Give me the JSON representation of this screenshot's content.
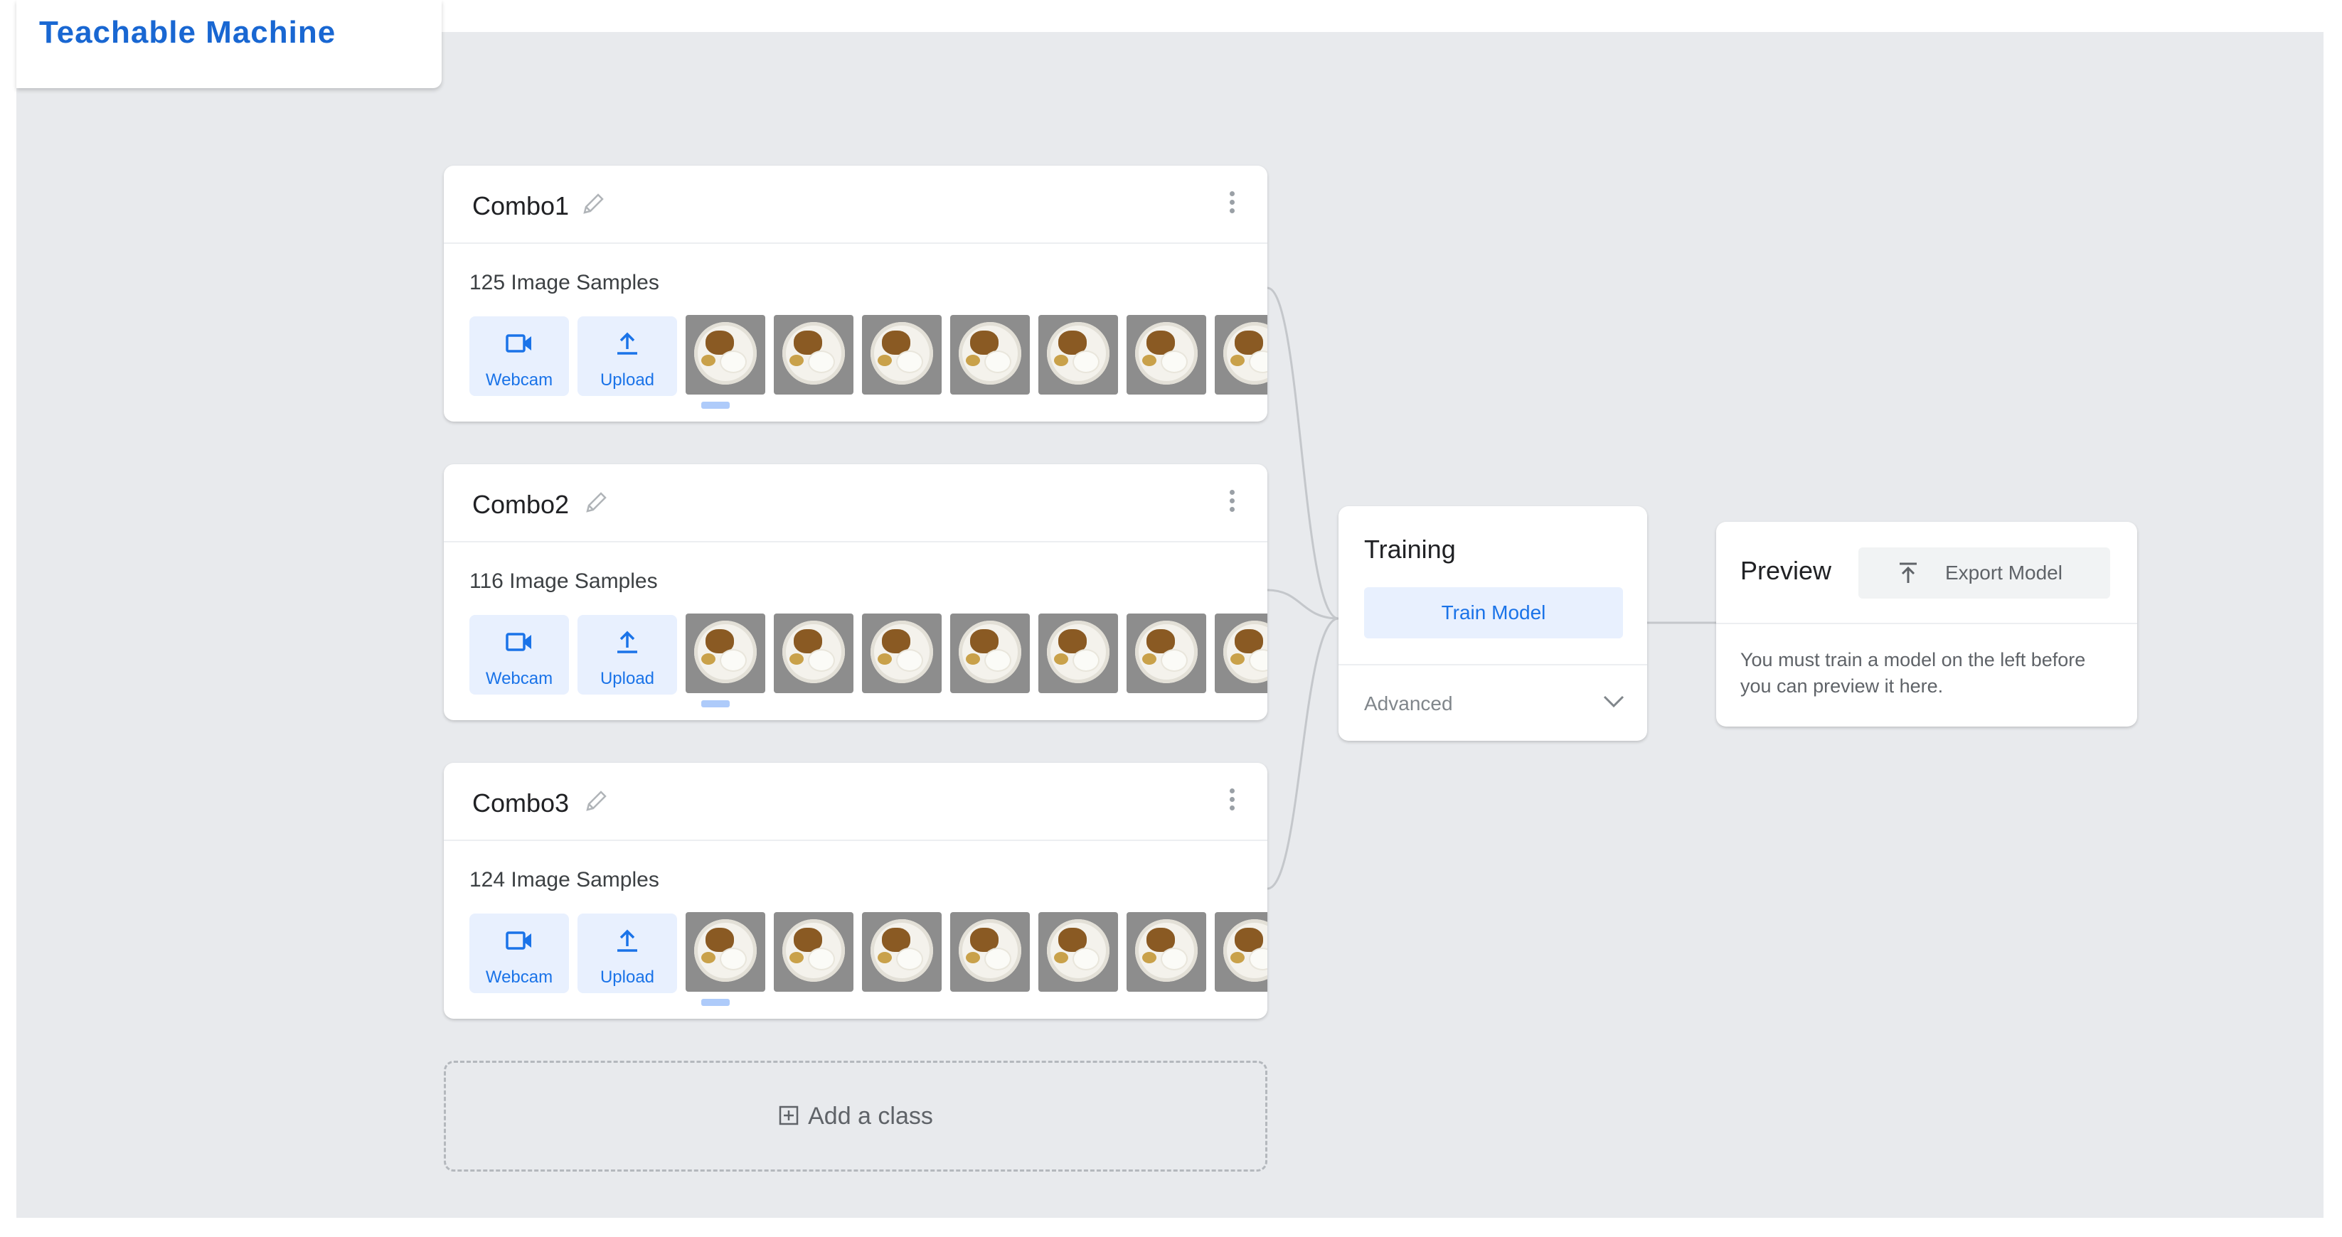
{
  "app": {
    "title": "Teachable Machine"
  },
  "classes": [
    {
      "name": "Combo1",
      "samples": "125 Image Samples",
      "webcam_label": "Webcam",
      "upload_label": "Upload"
    },
    {
      "name": "Combo2",
      "samples": "116 Image Samples",
      "webcam_label": "Webcam",
      "upload_label": "Upload"
    },
    {
      "name": "Combo3",
      "samples": "124 Image Samples",
      "webcam_label": "Webcam",
      "upload_label": "Upload"
    }
  ],
  "add_class": {
    "label": "Add a class"
  },
  "training": {
    "title": "Training",
    "button_label": "Train Model",
    "advanced_label": "Advanced"
  },
  "preview": {
    "title": "Preview",
    "export_label": "Export Model",
    "message": "You must train a model on the left before you can preview it here."
  },
  "icons": {
    "edit": "pencil-icon",
    "menu": "more-vert-icon",
    "webcam": "videocam-icon",
    "upload": "upload-icon",
    "add": "add-box-icon",
    "expand": "chevron-down-icon",
    "export": "export-icon"
  },
  "colors": {
    "brand": "#1967d2",
    "accent": "#1a73e8",
    "accent_light": "#e8f0fe",
    "canvas": "#e8eaed"
  }
}
